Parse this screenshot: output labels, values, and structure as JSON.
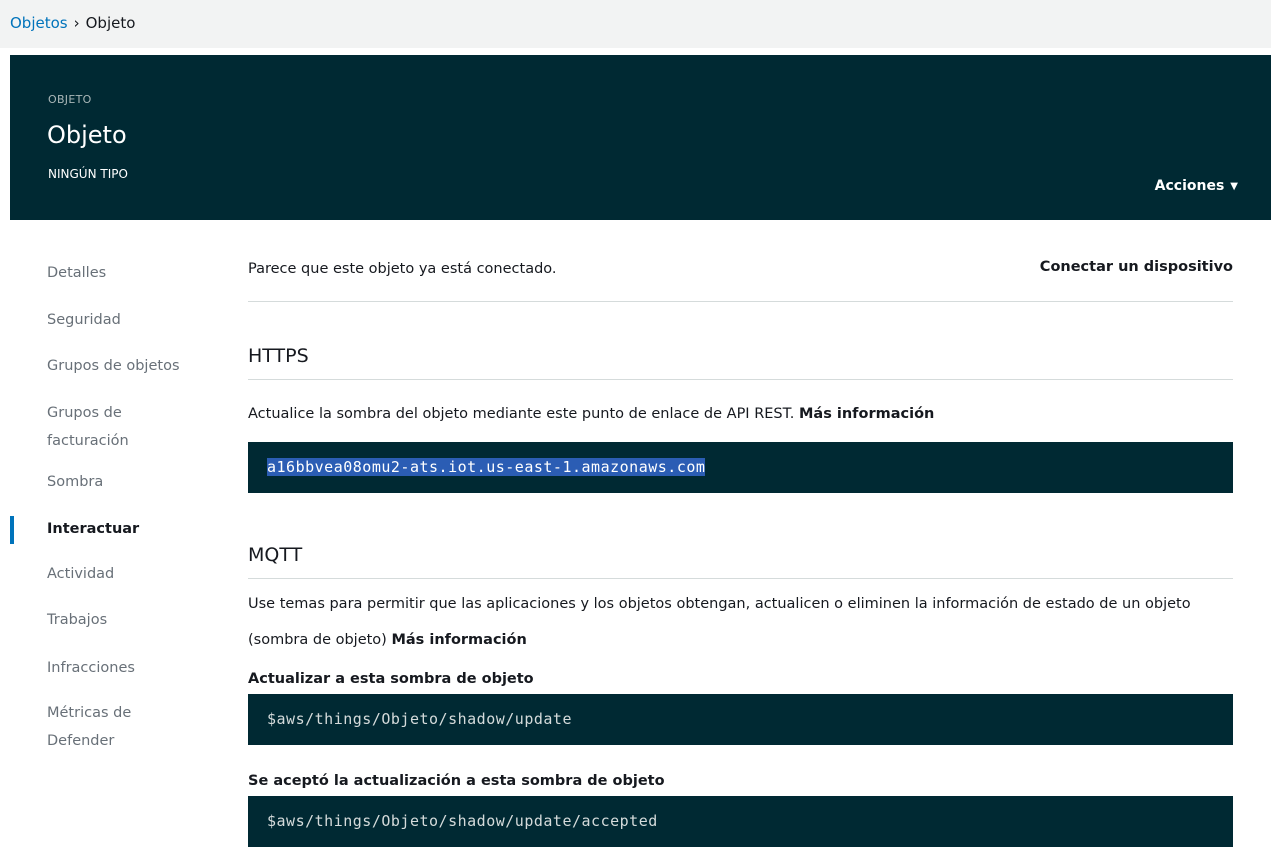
{
  "breadcrumb": {
    "parent": "Objetos",
    "separator": "›",
    "current": "Objeto"
  },
  "header": {
    "overline": "OBJETO",
    "title": "Objeto",
    "subtitle": "NINGÚN TIPO",
    "actions_label": "Acciones",
    "actions_icon": "caret-down-icon"
  },
  "sidenav": {
    "items": [
      {
        "label": "Detalles",
        "active": false
      },
      {
        "label": "Seguridad",
        "active": false
      },
      {
        "label": "Grupos de objetos",
        "active": false
      },
      {
        "label": "Grupos de facturación",
        "active": false
      },
      {
        "label": "Sombra",
        "active": false
      },
      {
        "label": "Interactuar",
        "active": true
      },
      {
        "label": "Actividad",
        "active": false
      },
      {
        "label": "Trabajos",
        "active": false
      },
      {
        "label": "Infracciones",
        "active": false
      },
      {
        "label": "Métricas de Defender",
        "active": false
      }
    ]
  },
  "main": {
    "status_text": "Parece que este objeto ya está conectado.",
    "connect_label": "Conectar un dispositivo",
    "https": {
      "title": "HTTPS",
      "description": "Actualice la sombra del objeto mediante este punto de enlace de API REST.",
      "more_label": "Más información",
      "endpoint": "a16bbvea08omu2-ats.iot.us-east-1.amazonaws.com"
    },
    "mqtt": {
      "title": "MQTT",
      "description": "Use temas para permitir que las aplicaciones y los objetos obtengan, actualicen o eliminen la información de estado de un objeto (sombra de objeto)",
      "more_label": "Más información",
      "topics": [
        {
          "label": "Actualizar a esta sombra de objeto",
          "topic": "$aws/things/Objeto/shadow/update"
        },
        {
          "label": "Se aceptó la actualización a esta sombra de objeto",
          "topic": "$aws/things/Objeto/shadow/update/accepted"
        }
      ]
    }
  },
  "colors": {
    "header_bg": "#002933",
    "accent": "#0073bb",
    "selection": "#2b5db4"
  }
}
